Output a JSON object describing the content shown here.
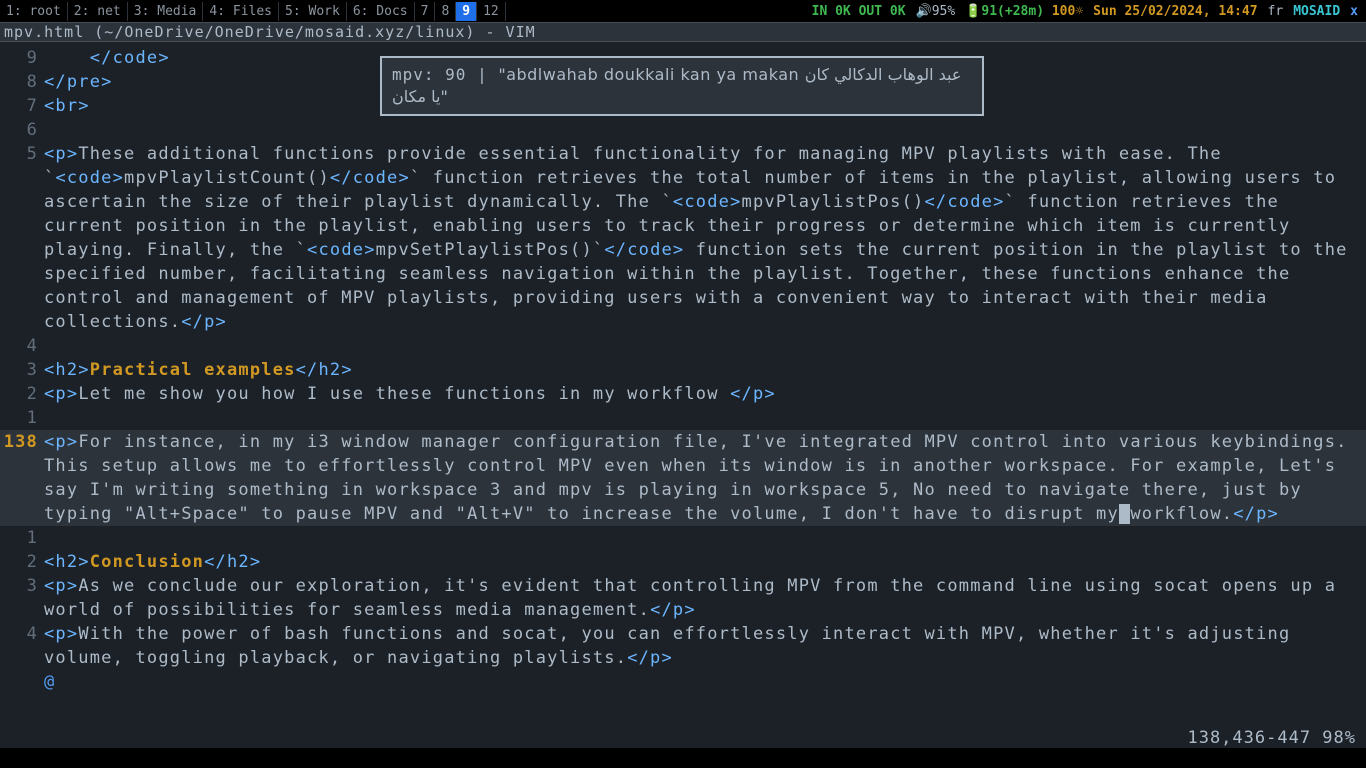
{
  "taskbar": {
    "workspaces": [
      {
        "label": "1: root",
        "active": false
      },
      {
        "label": "2: net",
        "active": false
      },
      {
        "label": "3: Media",
        "active": false
      },
      {
        "label": "4: Files",
        "active": false
      },
      {
        "label": "5: Work",
        "active": false
      },
      {
        "label": "6: Docs",
        "active": false
      },
      {
        "label": "7",
        "active": false
      },
      {
        "label": "8",
        "active": false
      },
      {
        "label": "9",
        "active": true
      },
      {
        "label": "12",
        "active": false
      }
    ],
    "net": "IN 0K OUT 0K",
    "volume": "🔊95%",
    "battery": "🔋91(+28m)",
    "brightness": "100☼",
    "date": "Sun 25/02/2024, 14:47",
    "kb": "fr",
    "user": "MOSAID",
    "xlabel": "x"
  },
  "titlebar": "mpv.html (~/OneDrive/OneDrive/mosaid.xyz/linux) - VIM",
  "overlay": {
    "line1_prefix": "mpv: 90 | ",
    "line1_quote": "\"abdlwahab doukkali kan ya makan عبد الوهاب الدكالي كان",
    "line2": "يا مكان\""
  },
  "lines": {
    "l9": {
      "rel": "9",
      "tag_open": "</code>"
    },
    "l8": {
      "rel": "8",
      "tag_open": "</pre>"
    },
    "l7": {
      "rel": "7",
      "tag_open": "<br>"
    },
    "l6": {
      "rel": "6"
    },
    "l5": {
      "rel": "5",
      "p_open": "<p>",
      "t1": "These additional functions provide essential functionality for managing MPV playlists with ease. The `",
      "c1o": "<code>",
      "c1t": "mpvPlaylistCount()",
      "c1c": "</code>",
      "t2": "` function retrieves the total number of items in the playlist, allowing users to ascertain the size of their playlist dynamically. The `",
      "c2o": "<code>",
      "c2t": "mpvPlaylistPos()",
      "c2c": "</code>",
      "t3": "` function retrieves the current position in the playlist, enabling users to track their progress or determine which item is currently playing. Finally, the `",
      "c3o": "<code>",
      "c3t": "mpvSetPlaylistPos()`",
      "c3c": "</code>",
      "t4": " function sets the current position in the playlist to the specified number, facilitating seamless navigation within the playlist. Together, these functions enhance the control and management of MPV playlists, providing users with a convenient way to interact with their media collections.",
      "p_close": "</p>"
    },
    "l4": {
      "rel": "4"
    },
    "l3a": {
      "rel": "3",
      "h2o": "<h2>",
      "txt": "Practical examples",
      "h2c": "</h2>"
    },
    "l2a": {
      "rel": "2",
      "po": "<p>",
      "txt": "Let me show you how I use these functions in my workflow ",
      "pc": "</p>"
    },
    "l1a": {
      "rel": "1"
    },
    "current": {
      "abs": "138",
      "po": "<p>",
      "t1": "For instance, in my i3 window manager configuration file, I've integrated MPV control into various keybindings. This setup allows me to effortlessly control MPV even when its window is in another workspace. For example, Let's say I'm writing something in workspace 3 and mpv is playing in workspace 5, No need to navigate there, just by typing \"Alt+Space\" to pause MPV and \"Alt+V\" to increase the volume, I don't have to disrupt my",
      "cursor": " ",
      "t2": "workflow.",
      "pc": "</p>"
    },
    "l1b": {
      "rel": "1"
    },
    "l2b": {
      "rel": "2",
      "h2o": "<h2>",
      "txt": "Conclusion",
      "h2c": "</h2>"
    },
    "l3b": {
      "rel": "3",
      "po": "<p>",
      "txt": "As we conclude our exploration, it's evident that controlling MPV from the command line using socat opens up a world of possibilities for seamless media management.",
      "pc": "</p>"
    },
    "l4b": {
      "rel": "4",
      "po": "<p>",
      "txt": "With the power of bash functions and socat, you can effortlessly interact with MPV, whether it's adjusting volume, toggling playback, or navigating playlists.",
      "pc": "</p>"
    },
    "at": "@"
  },
  "status": "138,436-447   98%"
}
